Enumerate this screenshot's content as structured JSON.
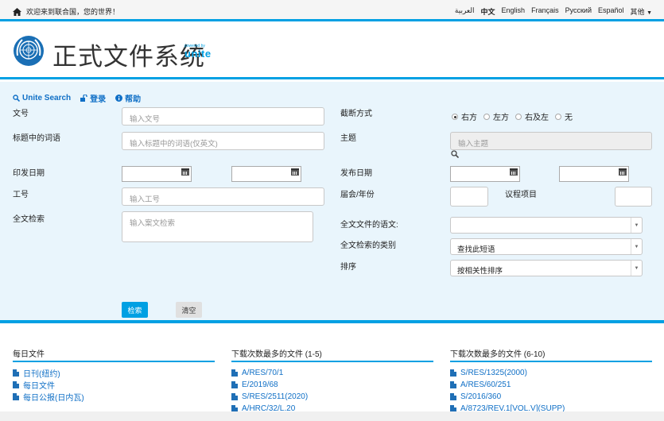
{
  "topbar": {
    "welcome": "欢迎来到联合国，您的世界！",
    "languages": [
      "العربية",
      "中文",
      "English",
      "Français",
      "Русский",
      "Español"
    ],
    "more": "其他"
  },
  "header": {
    "title": "正式文件系统",
    "powered_by": "powered by",
    "brand": "unite"
  },
  "links": {
    "unite_search": "Unite Search",
    "login": "登录",
    "help": "帮助"
  },
  "form": {
    "symbol_label": "文号",
    "symbol_placeholder": "输入文号",
    "title_words_label": "标题中的词语",
    "title_words_placeholder": "输入标题中的词语(仅英文)",
    "pub_date_label": "印发日期",
    "job_no_label": "工号",
    "job_no_placeholder": "输入工号",
    "fulltext_label": "全文检索",
    "fulltext_placeholder": "输入案文检索",
    "truncation_label": "截断方式",
    "truncation_options": [
      "右方",
      "左方",
      "右及左",
      "无"
    ],
    "subject_label": "主题",
    "subject_placeholder": "输入主题",
    "release_date_label": "发布日期",
    "session_label": "届会/年份",
    "agenda_label": "议程项目",
    "fulltext_lang_label": "全文文件的语文:",
    "fulltext_lang_value": "",
    "fulltext_type_label": "全文检索的类别",
    "fulltext_type_value": "查找此短语",
    "sort_label": "排序",
    "sort_value": "按相关性排序",
    "search_btn": "检索",
    "clear_btn": "清空"
  },
  "footer": {
    "daily": {
      "title": "每日文件",
      "items": [
        "日刊(纽约)",
        "每日文件",
        "每日公报(日内瓦)"
      ]
    },
    "top1": {
      "title": "下载次数最多的文件 (1-5)",
      "items": [
        "A/RES/70/1",
        "E/2019/68",
        "S/RES/2511(2020)",
        "A/HRC/32/L.20"
      ]
    },
    "top2": {
      "title": "下载次数最多的文件 (6-10)",
      "items": [
        "S/RES/1325(2000)",
        "A/RES/60/251",
        "S/2016/360",
        "A/8723/REV.1[VOL.V](SUPP)"
      ]
    }
  },
  "colors": {
    "accent": "#00a0e3",
    "link": "#0f6fc6"
  }
}
